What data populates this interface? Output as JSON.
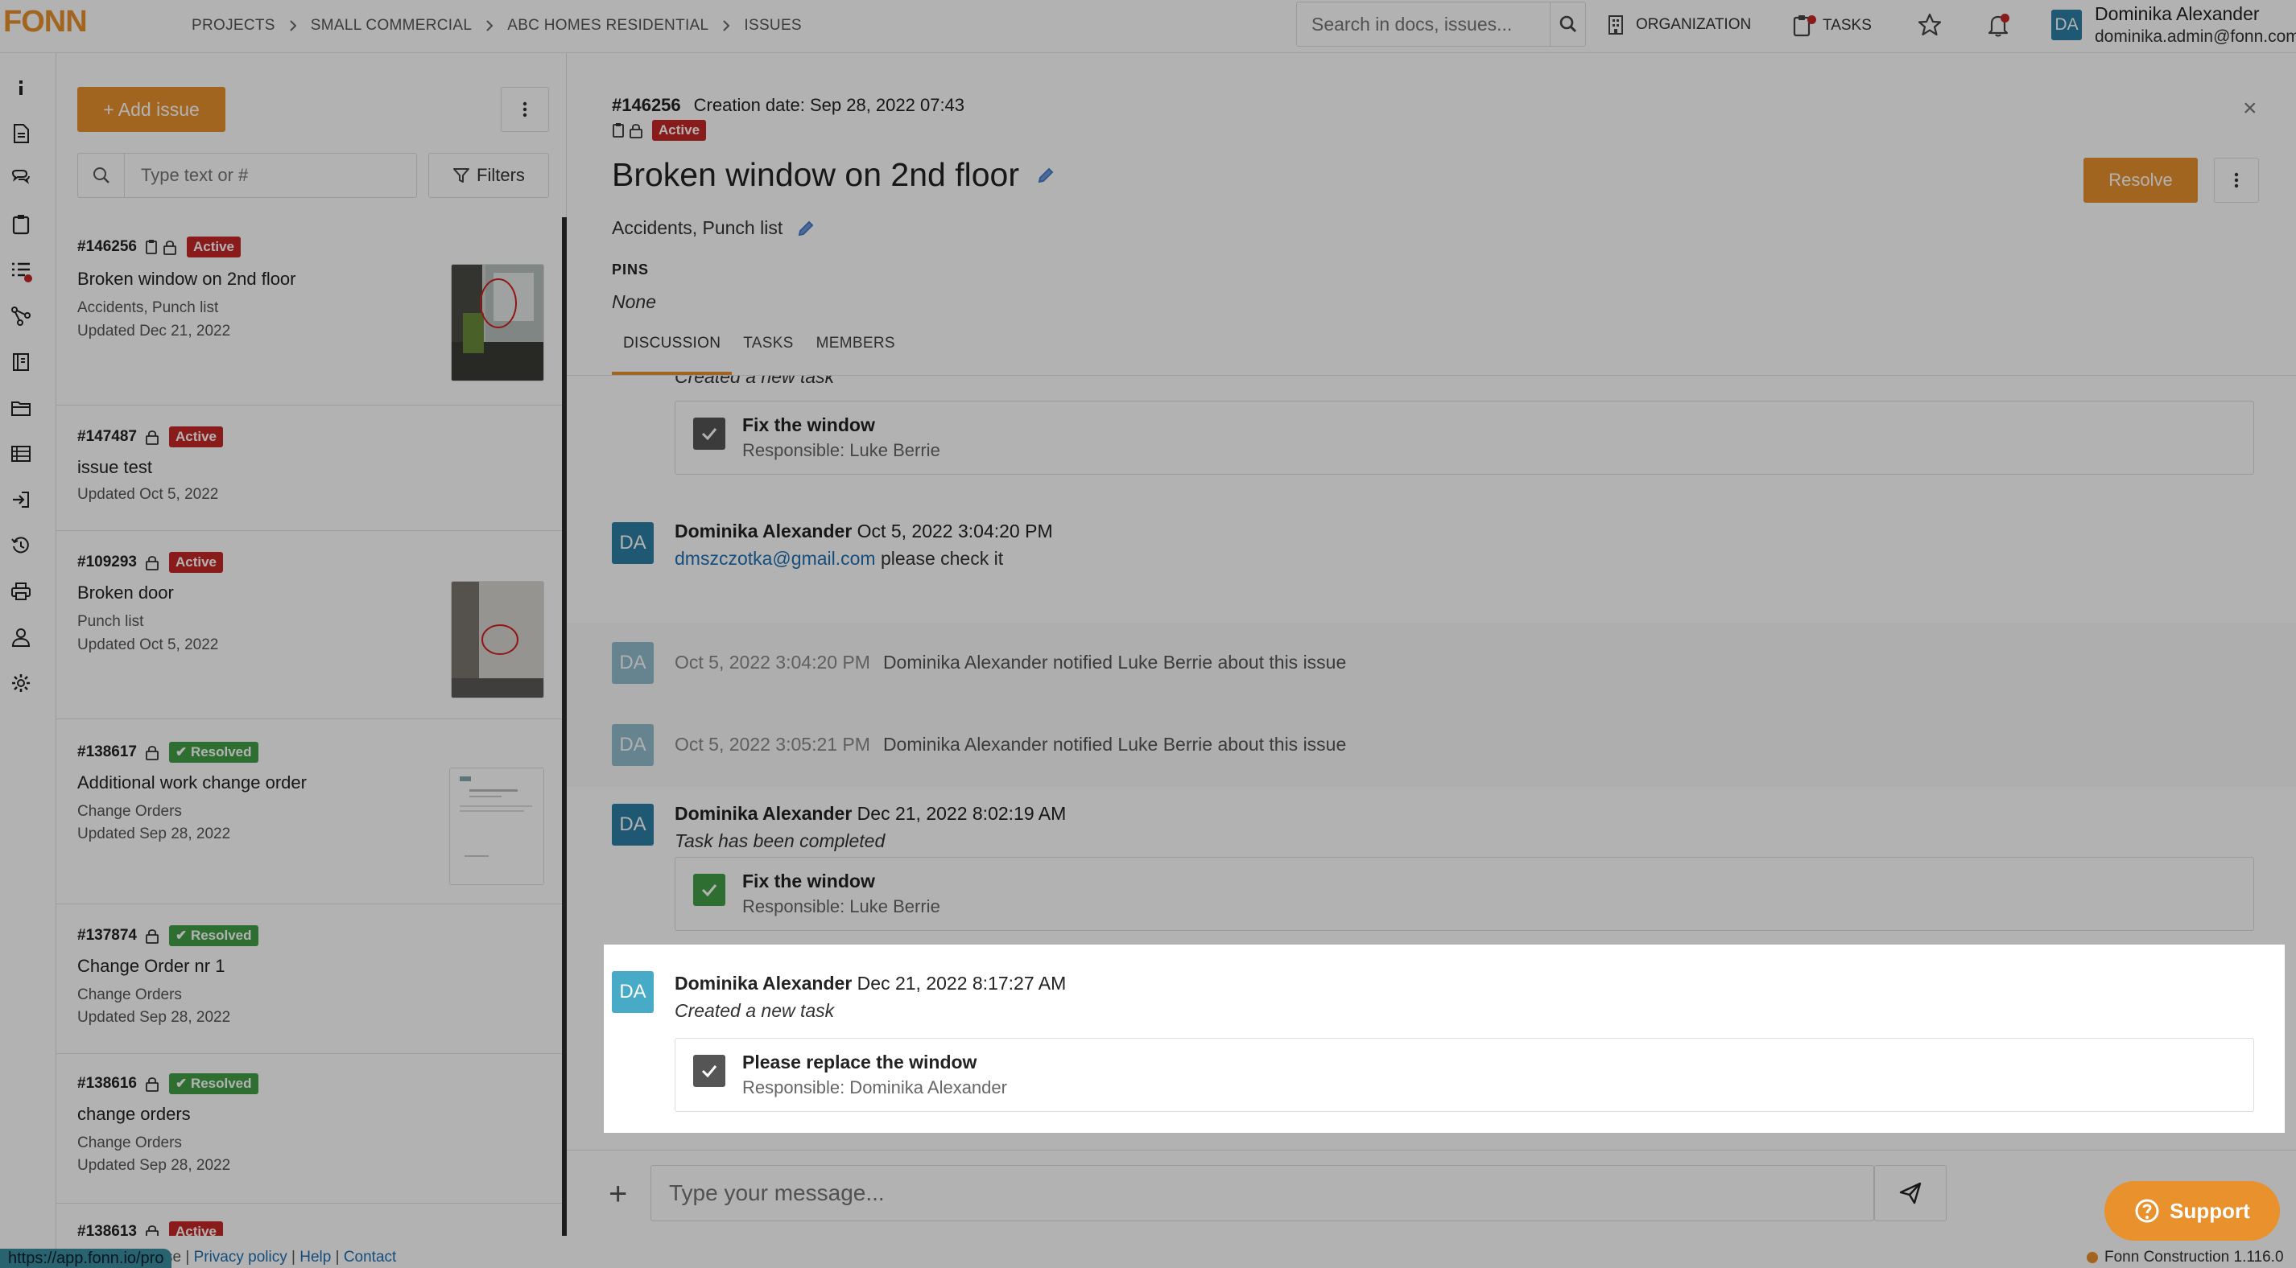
{
  "brand": {
    "logo": "FONN",
    "accent": "#e8912d"
  },
  "breadcrumbs": [
    "PROJECTS",
    "SMALL COMMERCIAL",
    "ABC HOMES RESIDENTIAL",
    "ISSUES"
  ],
  "search": {
    "placeholder": "Search in docs, issues..."
  },
  "topnav": {
    "organization": "ORGANIZATION",
    "tasks": "TASKS"
  },
  "user": {
    "initials": "DA",
    "name": "Dominika Alexander",
    "email": "dominika.admin@fonn.com"
  },
  "sidebar": {
    "icons": [
      "info-icon",
      "document-icon",
      "chat-icon",
      "clipboard-icon",
      "checklist-icon",
      "workflow-icon",
      "book-icon",
      "folder-icon",
      "table-icon",
      "sign-in-icon",
      "history-icon",
      "print-icon",
      "person-icon",
      "gear-icon"
    ]
  },
  "list": {
    "add_label": "+ Add issue",
    "search_placeholder": "Type text or #",
    "filters_label": "Filters",
    "items": [
      {
        "num": "#146256",
        "status": "Active",
        "title": "Broken window on 2nd floor",
        "categories": "Accidents, Punch list",
        "updated": "Updated Dec 21, 2022"
      },
      {
        "num": "#147487",
        "status": "Active",
        "title": "issue test",
        "categories": "",
        "updated": "Updated Oct 5, 2022"
      },
      {
        "num": "#109293",
        "status": "Active",
        "title": "Broken door",
        "categories": "Punch list",
        "updated": "Updated Oct 5, 2022"
      },
      {
        "num": "#138617",
        "status": "Resolved",
        "title": "Additional work change order",
        "categories": "Change Orders",
        "updated": "Updated Sep 28, 2022"
      },
      {
        "num": "#137874",
        "status": "Resolved",
        "title": "Change Order nr 1",
        "categories": "Change Orders",
        "updated": "Updated Sep 28, 2022"
      },
      {
        "num": "#138616",
        "status": "Resolved",
        "title": "change orders",
        "categories": "Change Orders",
        "updated": "Updated Sep 28, 2022"
      },
      {
        "num": "#138613",
        "status": "Active"
      }
    ]
  },
  "detail": {
    "num": "#146256",
    "creation": "Creation date: Sep 28, 2022 07:43",
    "status": "Active",
    "title": "Broken window on 2nd floor",
    "resolve_label": "Resolve",
    "categories": "Accidents, Punch list",
    "pins_label": "PINS",
    "pins_value": "None",
    "tabs": [
      "DISCUSSION",
      "TASKS",
      "MEMBERS"
    ],
    "close_label": "×"
  },
  "discussion": {
    "partial_text": "Created a new task",
    "task1": {
      "name": "Fix the window",
      "responsible": "Responsible: Luke Berrie"
    },
    "msg1": {
      "author": "Dominika Alexander",
      "time": "Oct 5, 2022 3:04:20 PM",
      "link": "dmszczotka@gmail.com",
      "text": "please check it"
    },
    "notif1": {
      "time": "Oct 5, 2022 3:04:20 PM",
      "text": "Dominika Alexander notified Luke Berrie about this issue"
    },
    "notif2": {
      "time": "Oct 5, 2022 3:05:21 PM",
      "text": "Dominika Alexander notified Luke Berrie about this issue"
    },
    "msg2": {
      "author": "Dominika Alexander",
      "time": "Dec 21, 2022 8:02:19 AM",
      "text": "Task has been completed"
    },
    "task2": {
      "name": "Fix the window",
      "responsible": "Responsible: Luke Berrie"
    },
    "msg3": {
      "author": "Dominika Alexander",
      "time": "Dec 21, 2022 8:17:27 AM",
      "text": "Created a new task"
    },
    "task3": {
      "name": "Please replace the window",
      "responsible": "Responsible: Dominika Alexander"
    }
  },
  "composer": {
    "placeholder": "Type your message..."
  },
  "support_label": "Support",
  "footer": {
    "url": "https://app.fonn.io/pro",
    "links_prefix": "se",
    "privacy": "Privacy policy",
    "help": "Help",
    "contact": "Contact",
    "version": "Fonn Construction 1.116.0"
  },
  "colors": {
    "active": "#c62828",
    "resolved": "#43a047",
    "avatar": "#2d7fa5",
    "link": "#1f6fb2"
  }
}
